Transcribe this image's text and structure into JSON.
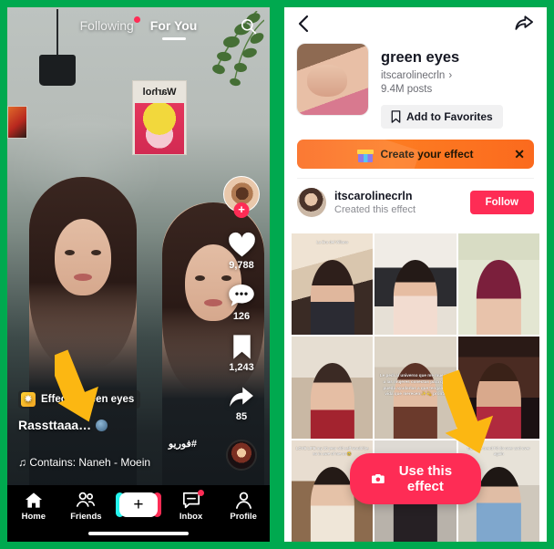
{
  "colors": {
    "border_green": "#00a94f",
    "tiktok_pink": "#fe2c55",
    "tiktok_cyan": "#25f4ee",
    "promo_orange": "#fb6a1e",
    "arrow_yellow": "#fcb712"
  },
  "left_panel": {
    "header": {
      "following_tab": "Following",
      "foryou_tab": "For You",
      "search_icon": "search-icon",
      "following_badge": true
    },
    "action_rail": {
      "avatar": "creator-avatar",
      "follow_plus": "+",
      "like_count": "9,788",
      "comment_count": "126",
      "bookmark_count": "1,243",
      "share_count": "85",
      "music_disc": "spinning-record"
    },
    "caption": {
      "effect_label": "Effect · green eyes",
      "title": "Rassttaaa…",
      "hashtag": "#فوریو",
      "music": "♫ Contains: Naneh - Moein"
    },
    "nav": [
      {
        "label": "Home",
        "icon": "home-icon",
        "active": true
      },
      {
        "label": "Friends",
        "icon": "friends-icon",
        "active": false
      },
      {
        "label": "",
        "icon": "create-plus-icon",
        "active": false
      },
      {
        "label": "Inbox",
        "icon": "inbox-icon",
        "active": false,
        "badge": true
      },
      {
        "label": "Profile",
        "icon": "profile-icon",
        "active": false
      }
    ]
  },
  "right_panel": {
    "top": {
      "back_icon": "back-chevron-icon",
      "share_icon": "share-arrow-icon"
    },
    "effect": {
      "title": "green eyes",
      "author": "itscarolinecrln",
      "author_chevron": "›",
      "posts": "9.4M posts",
      "favorites_label": "Add to Favorites",
      "favorites_icon": "bookmark-icon"
    },
    "promo": {
      "text": "Create your effect",
      "gift_icon": "gift-icon",
      "close_icon": "close-icon"
    },
    "creator": {
      "name": "itscarolinecrln",
      "subtitle": "Created this effect",
      "follow_label": "Follow"
    },
    "cta": {
      "label": "Use this effect",
      "icon": "camera-icon"
    },
    "grid": [
      {
        "overlay": "La Era del Villano",
        "overlay_pos": "top",
        "bg": "linear-gradient(165deg,#efe3d3 0 30%,#d9c6ae 30% 55%,#3a2b25 55%)",
        "fig": "linear-gradient(180deg,#2e1f1b 0 34%,#e0b79d 34% 56%,#2b2b33 56%)"
      },
      {
        "overlay": "",
        "overlay_pos": "top",
        "bg": "linear-gradient(180deg,#f0ece6 0 34%,#2c2c30 34% 72%,#e6e0d6 72%)",
        "fig": "linear-gradient(180deg,#241a17 0 30%,#e6bda2 30% 48%,#f2dcd0 48%)"
      },
      {
        "overlay": "",
        "overlay_pos": "top",
        "bg": "linear-gradient(180deg,#d8dcc4 0 26%,#e3e6d2 26%)",
        "fig": "linear-gradient(180deg,#7b1f3c 0 52%,#e8c3ab 52%)"
      },
      {
        "overlay": "",
        "overlay_pos": "top",
        "bg": "linear-gradient(180deg,#e6ded2 0 40%,#c9b8a4 40%)",
        "fig": "linear-gradient(180deg,#3b2a24 0 26%,#e5bea4 26% 62%,#a3232f 62%)"
      },
      {
        "overlay": "Le pedí al universo que me muestre a las mujeres conectas para que pueda ayudarlas a que tengan la vida que merecen ✨💫 pronto",
        "overlay_pos": "mid",
        "bg": "linear-gradient(180deg,#ded6c8 0 30%,#cfc4b4 30%)",
        "fig": "linear-gradient(180deg,#5b3226 0 22%,#e3bda3 22% 58%,#6b3a2c 58%)"
      },
      {
        "overlay": "",
        "overlay_pos": "top",
        "bg": "linear-gradient(180deg,#2a1a16 0 20%,#4a2b22 20% 60%,#1b1113 60%)",
        "fig": "linear-gradient(180deg,#3a2218 0 24%,#d9a98c 24% 58%,#b02a3e 58%)"
      },
      {
        "overlay": "LOVE LIFE my 10 year old self would be so in awe of me rn 🥹",
        "overlay_pos": "top",
        "bg": "linear-gradient(180deg,#e8ddd0 0 40%,#8c6b4e 40%)",
        "fig": "linear-gradient(180deg,#241a16 0 24%,#e5c2a8 24% 52%,#efe6d8 52%)"
      },
      {
        "overlay": "",
        "overlay_pos": "top",
        "bg": "linear-gradient(180deg,#dedad4 0 62%,#b8b2aa 62%)",
        "fig": "linear-gradient(180deg,#2a2320 0 30%,#262024 30%)"
      },
      {
        "overlay": "that one trend I'd do over and over again",
        "overlay_pos": "top",
        "bg": "linear-gradient(180deg,#e7e2d8 0 44%,#cfc8bc 44%)",
        "fig": "linear-gradient(180deg,#1e1714 0 26%,#e0bda5 26% 48%,#7fa7cd 48%)"
      }
    ]
  }
}
